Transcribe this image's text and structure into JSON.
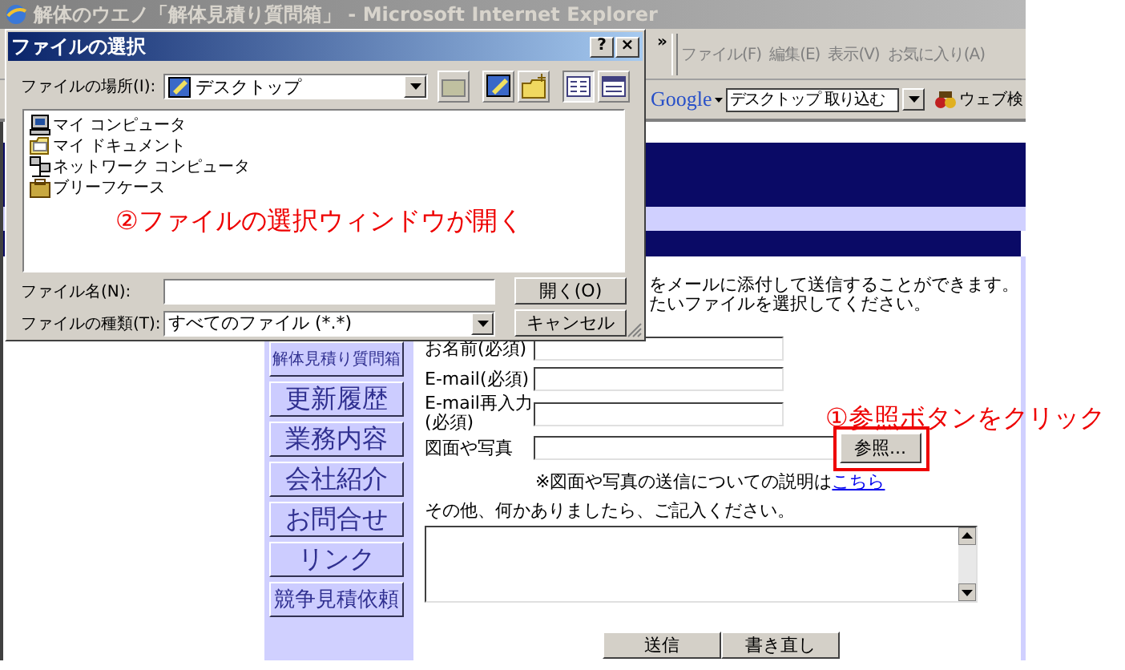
{
  "browser": {
    "title": "解体のウエノ「解体見積り質問箱」 - Microsoft Internet Explorer",
    "chevron": "»",
    "menu": [
      "ファイル(F)",
      "編集(E)",
      "表示(V)",
      "お気に入り(A)"
    ],
    "google": {
      "logo": "Google",
      "search_value": "デスクトップ 取り込む",
      "search_button": "ウェブ検"
    }
  },
  "page": {
    "intro_lines": [
      "をメールに添付して送信することができます。",
      "たいファイルを選択してください。"
    ],
    "nav": [
      "解体見積り質問箱",
      "更新履歴",
      "業務内容",
      "会社紹介",
      "お問合せ",
      "リンク",
      "競争見積依頼"
    ],
    "form": {
      "fields": [
        {
          "label": "お名前(必須)",
          "kind": "text"
        },
        {
          "label": "E-mail(必須)",
          "kind": "text"
        },
        {
          "label": "E-mail再入力(必須)",
          "kind": "text"
        },
        {
          "label": "図面や写真",
          "kind": "file",
          "button": "参照..."
        }
      ],
      "note": "※図面や写真の送信についての説明は",
      "note_link": "こちら",
      "comment_label": "その他、何かありましたら、ご記入ください。",
      "buttons": [
        "送信",
        "書き直し"
      ]
    }
  },
  "dialog": {
    "title": "ファイルの選択",
    "help": "?",
    "close": "×",
    "location_label": "ファイルの場所(I):",
    "location_value": "デスクトップ",
    "items": [
      {
        "label": "マイ コンピュータ",
        "kind": "computer"
      },
      {
        "label": "マイ ドキュメント",
        "kind": "folder"
      },
      {
        "label": "ネットワーク コンピュータ",
        "kind": "network"
      },
      {
        "label": "ブリーフケース",
        "kind": "briefcase"
      }
    ],
    "filename_label": "ファイル名(N):",
    "filetype_label": "ファイルの種類(T):",
    "filetype_value": "すべてのファイル (*.*)",
    "open_button": "開く(O)",
    "cancel_button": "キャンセル"
  },
  "annotations": [
    {
      "text": "②ファイルの選択ウィンドウが開く",
      "kind": "dialog-note"
    },
    {
      "text": "①参照ボタンをクリック",
      "kind": "button-note"
    }
  ]
}
